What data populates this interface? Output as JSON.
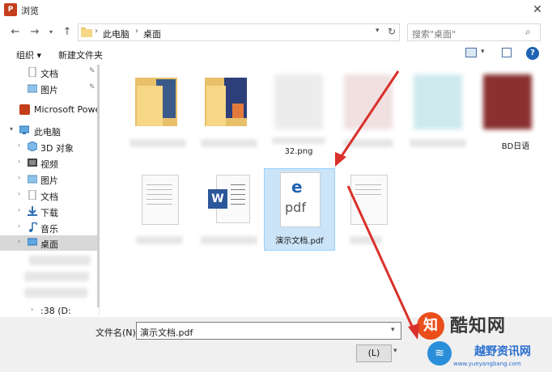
{
  "window": {
    "title": "浏览",
    "app_icon_letter": "P"
  },
  "address": {
    "crumb_pc": "此电脑",
    "crumb_desktop": "桌面"
  },
  "search": {
    "placeholder": "搜索\"桌面\""
  },
  "toolbar": {
    "organize": "组织 ▾",
    "new_folder": "新建文件夹"
  },
  "sidebar": {
    "items": [
      {
        "label": "文档",
        "icon": "document-icon",
        "pinned": true
      },
      {
        "label": "图片",
        "icon": "picture-icon",
        "pinned": true
      },
      {
        "label": "Microsoft Power",
        "icon": "powerpoint-icon"
      },
      {
        "label": "此电脑",
        "icon": "computer-icon"
      },
      {
        "label": "3D 对象",
        "icon": "3d-object-icon"
      },
      {
        "label": "视频",
        "icon": "video-icon"
      },
      {
        "label": "图片",
        "icon": "picture-icon"
      },
      {
        "label": "文档",
        "icon": "document-icon"
      },
      {
        "label": "下载",
        "icon": "download-icon"
      },
      {
        "label": "音乐",
        "icon": "music-icon"
      },
      {
        "label": "桌面",
        "icon": "desktop-icon",
        "selected": true
      },
      {
        "label": ":38 (D:",
        "icon": "drive-icon"
      }
    ]
  },
  "files": [
    {
      "name": "",
      "type": "folder"
    },
    {
      "name": "",
      "type": "folder"
    },
    {
      "name": "32.png",
      "type": "image"
    },
    {
      "name": "",
      "type": "image"
    },
    {
      "name": "",
      "type": "image"
    },
    {
      "name": "BD日语",
      "type": "image"
    },
    {
      "name": "",
      "type": "document"
    },
    {
      "name": "",
      "type": "word"
    },
    {
      "name": "演示文档.pdf",
      "type": "pdf",
      "selected": true,
      "thumb_text": "pdf"
    },
    {
      "name": "",
      "type": "document"
    }
  ],
  "footer": {
    "filename_label": "文件名(N):",
    "filename_value": "演示文档.pdf",
    "open_button": "(L)"
  },
  "watermark": {
    "brand": "酷知网",
    "sub": "越野资讯网",
    "url": "www.yueyangbang.com"
  },
  "colors": {
    "accent": "#1e63b4",
    "selection": "#cce4f7",
    "arrow": "#d9302a"
  }
}
